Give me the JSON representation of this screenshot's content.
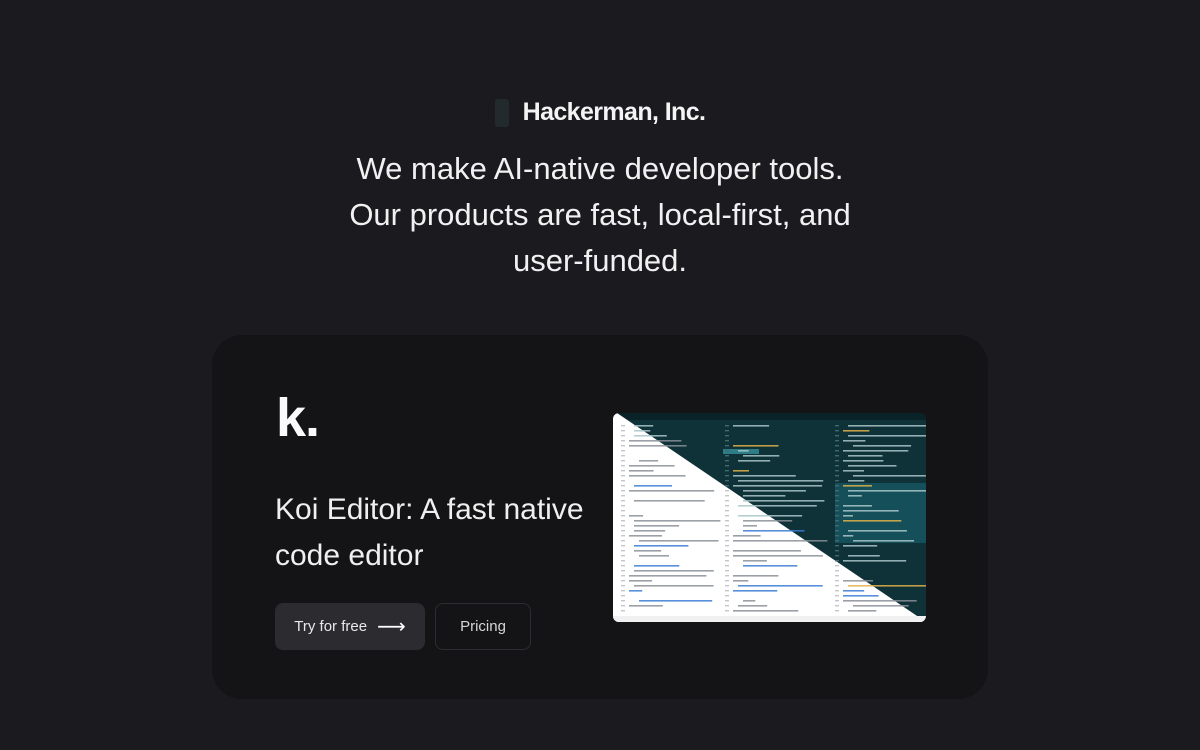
{
  "brand": {
    "name": "Hackerman, Inc.",
    "logo_icon": "hackerman-logo-icon"
  },
  "tagline": {
    "line1": "We make AI-native developer tools.",
    "line2": "Our products are fast, local-first, and",
    "line3": "user-funded."
  },
  "product": {
    "logo_text": "k.",
    "title": "Koi Editor: A fast native code editor",
    "try_label": "Try for free",
    "try_icon": "arrow-right-icon",
    "pricing_label": "Pricing",
    "screenshot": "koi-editor-screenshot"
  },
  "colors": {
    "background": "#1b1b1f",
    "card": "#141416",
    "button_primary": "#2b2b30",
    "editor_dark": "#0f3138",
    "editor_light": "#ffffff"
  }
}
